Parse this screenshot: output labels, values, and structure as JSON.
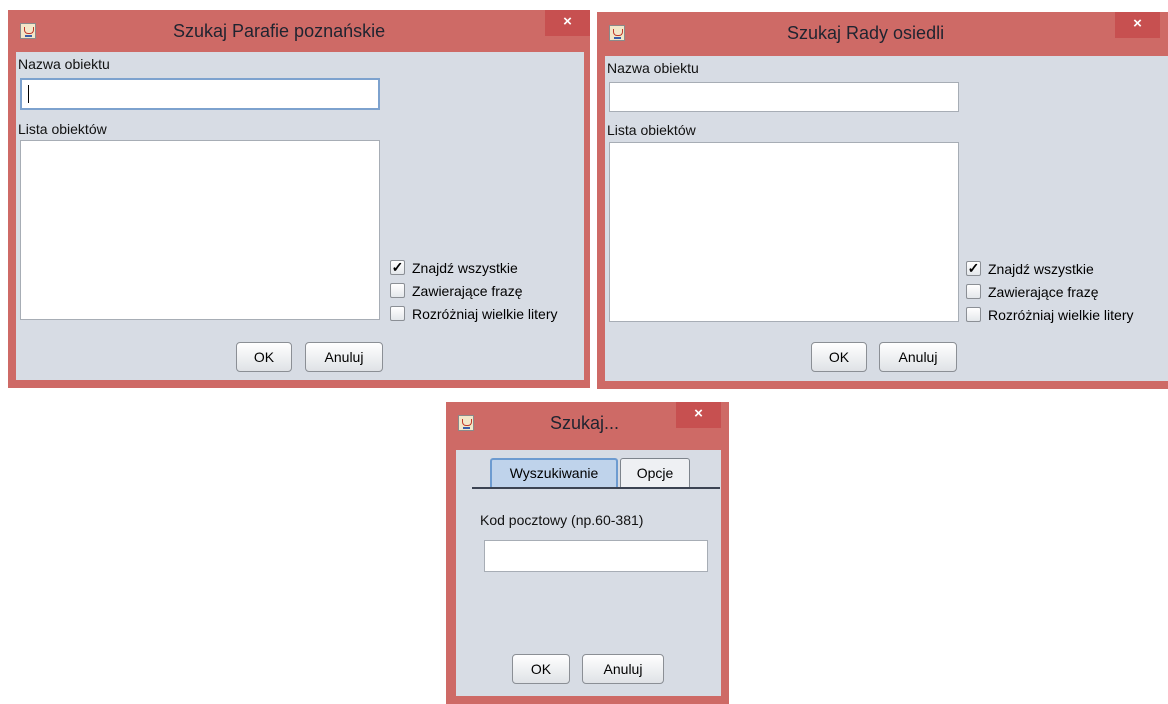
{
  "dialog_parafie": {
    "title": "Szukaj    Parafie poznańskie",
    "close_glyph": "×",
    "name_label": "Nazwa obiektu",
    "name_value": "",
    "list_label": "Lista obiektów",
    "list_items": [],
    "checkboxes": [
      {
        "label": "Znajdź wszystkie",
        "checked": true,
        "mark": "✓"
      },
      {
        "label": "Zawierające frazę",
        "checked": false,
        "mark": ""
      },
      {
        "label": "Rozróżniaj wielkie litery",
        "checked": false,
        "mark": ""
      }
    ],
    "ok_label": "OK",
    "cancel_label": "Anuluj"
  },
  "dialog_rady": {
    "title": "Szukaj    Rady osiedli",
    "close_glyph": "×",
    "name_label": "Nazwa obiektu",
    "name_value": "",
    "list_label": "Lista obiektów",
    "list_items": [],
    "checkboxes": [
      {
        "label": "Znajdź wszystkie",
        "checked": true,
        "mark": "✓"
      },
      {
        "label": "Zawierające frazę",
        "checked": false,
        "mark": ""
      },
      {
        "label": "Rozróżniaj wielkie litery",
        "checked": false,
        "mark": ""
      }
    ],
    "ok_label": "OK",
    "cancel_label": "Anuluj"
  },
  "dialog_kod": {
    "title": "Szukaj...",
    "close_glyph": "×",
    "tabs": [
      {
        "label": "Wyszukiwanie",
        "active": true
      },
      {
        "label": "Opcje",
        "active": false
      }
    ],
    "field_label": "Kod pocztowy (np.60-381)",
    "field_value": "",
    "ok_label": "OK",
    "cancel_label": "Anuluj"
  },
  "colors": {
    "frame": "#ce6a66",
    "close_button": "#c75050",
    "client_bg": "#d7dce4"
  },
  "icons": {
    "app": "java-cup-icon",
    "close": "close-icon",
    "check": "checkmark-icon"
  }
}
